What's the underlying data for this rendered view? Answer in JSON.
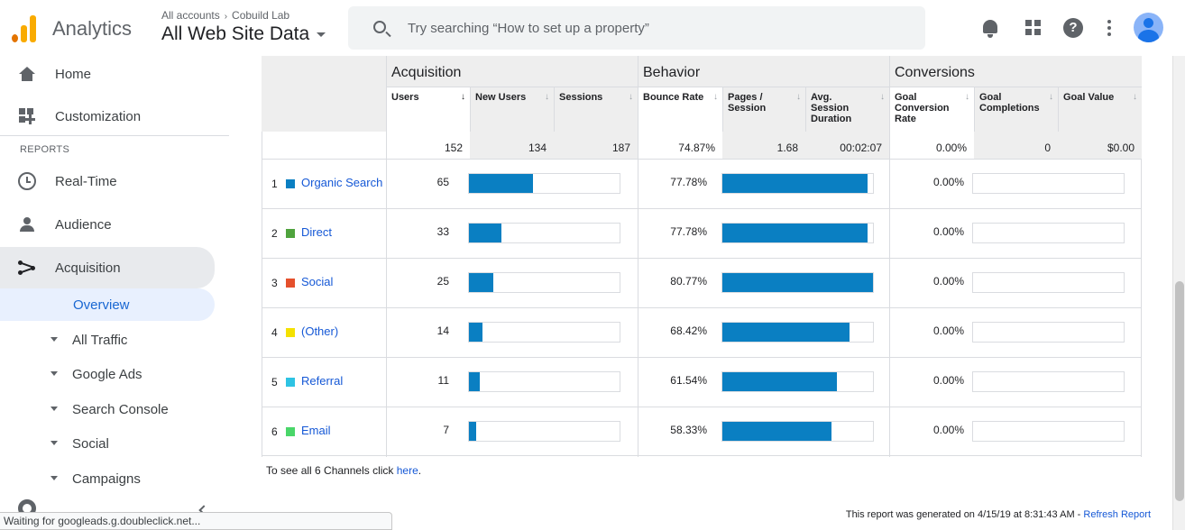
{
  "header": {
    "app_name": "Analytics",
    "breadcrumb": [
      "All accounts",
      "Cobuild Lab"
    ],
    "breadcrumb_sep": "›",
    "view_name": "All Web Site Data",
    "search_placeholder": "Try searching “How to set up a property”",
    "icons": [
      "bell-icon",
      "apps-grid-icon",
      "help-icon",
      "more-vert-icon",
      "account-avatar"
    ]
  },
  "sidebar": {
    "home": "Home",
    "customization": "Customization",
    "reports_header": "REPORTS",
    "realtime": "Real-Time",
    "audience": "Audience",
    "acquisition": "Acquisition",
    "overview": "Overview",
    "sub_items": [
      "All Traffic",
      "Google Ads",
      "Search Console",
      "Social",
      "Campaigns"
    ]
  },
  "status_bar": "Waiting for googleads.g.doubleclick.net...",
  "table": {
    "groups": {
      "acquisition": "Acquisition",
      "behavior": "Behavior",
      "conversions": "Conversions"
    },
    "columns": {
      "users": "Users",
      "new_users": "New Users",
      "sessions": "Sessions",
      "bounce_rate": "Bounce Rate",
      "pages_session": "Pages / Session",
      "avg_duration": "Avg. Session Duration",
      "goal_conv_rate": "Goal Conversion Rate",
      "goal_completions": "Goal Completions",
      "goal_value": "Goal Value"
    },
    "totals": {
      "users": "152",
      "new_users": "134",
      "sessions": "187",
      "bounce_rate": "74.87%",
      "pages_session": "1.68",
      "avg_duration": "00:02:07",
      "goal_conv_rate": "0.00%",
      "goal_completions": "0",
      "goal_value": "$0.00"
    },
    "rows": [
      {
        "rank": "1",
        "channel": "Organic Search",
        "color": "#0a7fc2",
        "users": "65",
        "users_bar": 0.4272,
        "bounce": "77.78%",
        "bounce_bar": 0.9627,
        "conv": "0.00%",
        "conv_bar": 0
      },
      {
        "rank": "2",
        "channel": "Direct",
        "color": "#4fa33d",
        "users": "33",
        "users_bar": 0.2169,
        "bounce": "77.78%",
        "bounce_bar": 0.9627,
        "conv": "0.00%",
        "conv_bar": 0
      },
      {
        "rank": "3",
        "channel": "Social",
        "color": "#e5502c",
        "users": "25",
        "users_bar": 0.1643,
        "bounce": "80.77%",
        "bounce_bar": 1.0,
        "conv": "0.00%",
        "conv_bar": 0
      },
      {
        "rank": "4",
        "channel": "(Other)",
        "color": "#f4e100",
        "users": "14",
        "users_bar": 0.092,
        "bounce": "68.42%",
        "bounce_bar": 0.8471,
        "conv": "0.00%",
        "conv_bar": 0
      },
      {
        "rank": "5",
        "channel": "Referral",
        "color": "#2ec3e3",
        "users": "11",
        "users_bar": 0.0723,
        "bounce": "61.54%",
        "bounce_bar": 0.7619,
        "conv": "0.00%",
        "conv_bar": 0
      },
      {
        "rank": "6",
        "channel": "Email",
        "color": "#4ad669",
        "users": "7",
        "users_bar": 0.046,
        "bounce": "58.33%",
        "bounce_bar": 0.7222,
        "conv": "0.00%",
        "conv_bar": 0
      }
    ]
  },
  "footnote": {
    "text": "To see all 6 Channels click ",
    "link": "here",
    "end": "."
  },
  "generated": {
    "text": "This report was generated on 4/15/19 at 8:31:43 AM - ",
    "link": "Refresh Report"
  }
}
